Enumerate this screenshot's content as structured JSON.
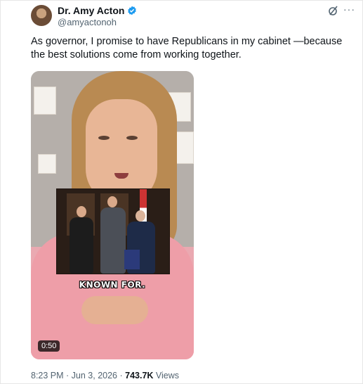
{
  "author": {
    "name": "Dr. Amy Acton",
    "handle": "@amyactonoh",
    "verified": true
  },
  "icons": {
    "verified": "verified-badge-icon",
    "grok": "grok-icon",
    "more": "more-options-icon"
  },
  "colors": {
    "verified_blue": "#1d9bf0",
    "text_primary": "#0f1419",
    "text_secondary": "#536471"
  },
  "tweet": {
    "text": "As governor, I promise to have Republicans in my cabinet —because the best solutions come from working together."
  },
  "media": {
    "caption": "KNOWN FOR.",
    "duration": "0:50"
  },
  "meta": {
    "time": "8:23 PM",
    "separator1": " · ",
    "date": "Jun 3, 2026",
    "separator2": " · ",
    "views_count": "743.7K",
    "views_label": " Views"
  }
}
